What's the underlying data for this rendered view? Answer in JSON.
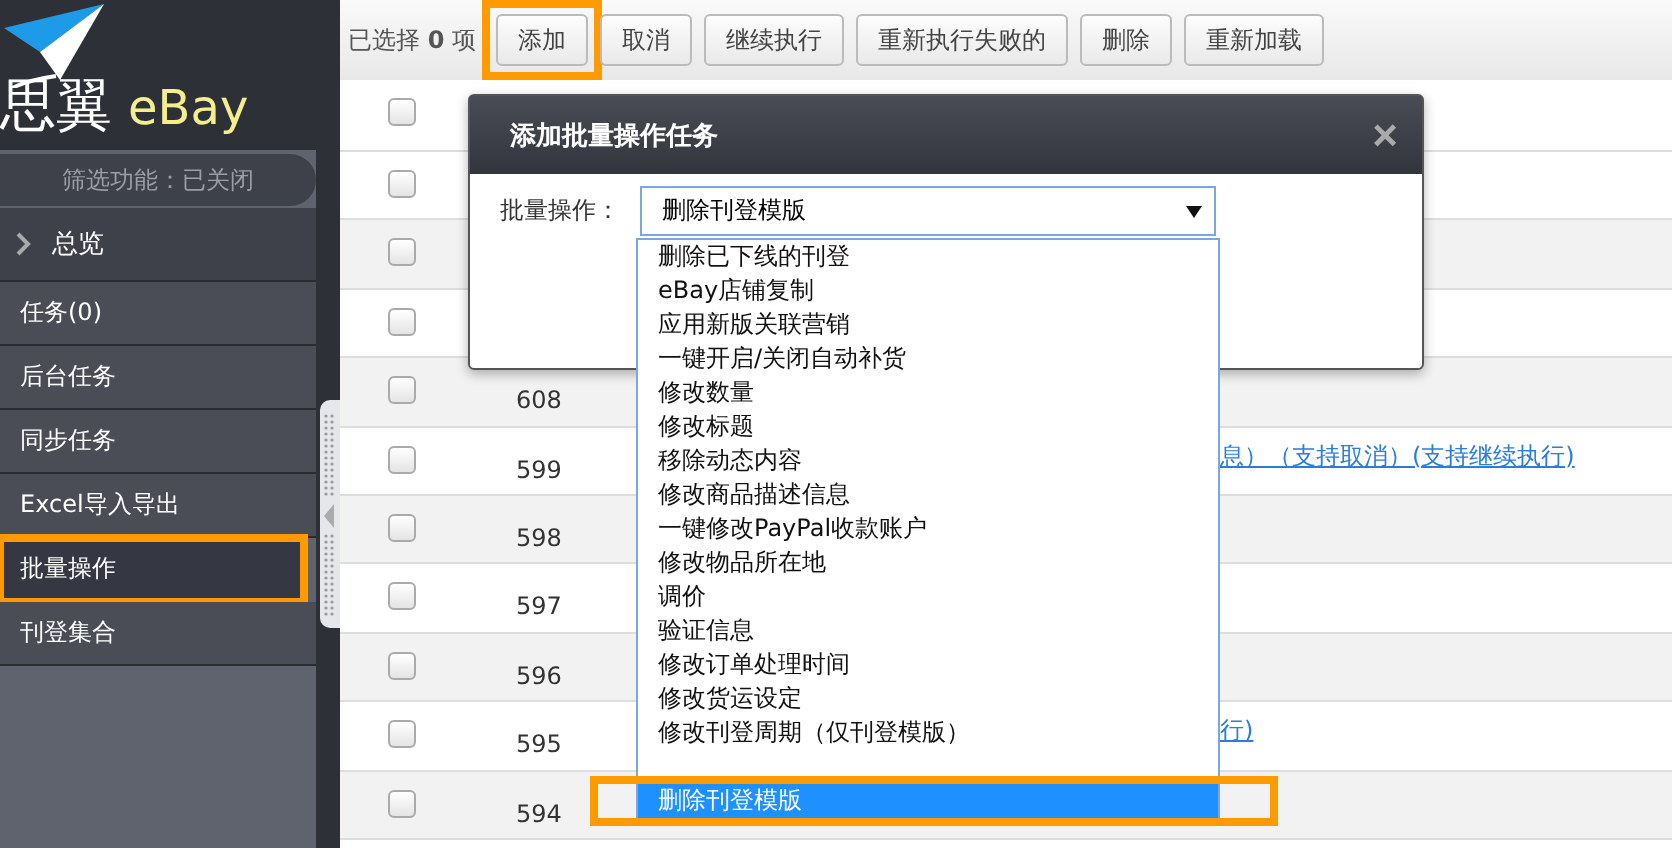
{
  "logo": {
    "name": "思翼",
    "brand": "eBay"
  },
  "sidebar": {
    "filter": "筛选功能：已关闭",
    "overview": "总览",
    "items": [
      {
        "label": "任务(0)",
        "selected": false,
        "highlighted": false
      },
      {
        "label": "后台任务",
        "selected": false,
        "highlighted": false
      },
      {
        "label": "同步任务",
        "selected": false,
        "highlighted": false
      },
      {
        "label": "Excel导入导出",
        "selected": false,
        "highlighted": false
      },
      {
        "label": "批量操作",
        "selected": true,
        "highlighted": true
      },
      {
        "label": "刊登集合",
        "selected": false,
        "highlighted": false
      }
    ]
  },
  "toolbar": {
    "selection": "已选择 **0** 项",
    "buttons": [
      {
        "label": "添加",
        "highlighted": true
      },
      {
        "label": "取消",
        "highlighted": false
      },
      {
        "label": "继续执行",
        "highlighted": false
      },
      {
        "label": "重新执行失败的",
        "highlighted": false
      },
      {
        "label": "删除",
        "highlighted": false
      },
      {
        "label": "重新加载",
        "highlighted": false
      }
    ]
  },
  "table": {
    "header_checked": false,
    "rows": [
      {
        "checked": false
      },
      {
        "checked": false
      },
      {
        "checked": false
      },
      {
        "checked": false,
        "number": "608"
      },
      {
        "checked": false,
        "number": "599",
        "column_3_tail": "息）（支持取消）(支持继续执行)"
      },
      {
        "checked": false,
        "number": "598"
      },
      {
        "checked": false,
        "number": "597"
      },
      {
        "checked": false,
        "number": "596"
      },
      {
        "checked": false,
        "number": "595",
        "column_3_tail": "行)"
      },
      {
        "checked": false,
        "number": "594"
      }
    ]
  },
  "dialog": {
    "title": "添加批量操作任务",
    "close": "×",
    "label": "批量操作：",
    "value": "删除刊登模版",
    "options": [
      {
        "label": "删除已下线的刊登",
        "selected": false,
        "highlighted": false
      },
      {
        "label": "eBay店铺复制",
        "selected": false,
        "highlighted": false
      },
      {
        "label": "应用新版关联营销",
        "selected": false,
        "highlighted": false
      },
      {
        "label": "一键开启/关闭自动补货",
        "selected": false,
        "highlighted": false
      },
      {
        "label": "修改数量",
        "selected": false,
        "highlighted": false
      },
      {
        "label": "修改标题",
        "selected": false,
        "highlighted": false
      },
      {
        "label": "移除动态内容",
        "selected": false,
        "highlighted": false
      },
      {
        "label": "修改商品描述信息",
        "selected": false,
        "highlighted": false
      },
      {
        "label": "一键修改PayPal收款账户",
        "selected": false,
        "highlighted": false
      },
      {
        "label": "修改物品所在地",
        "selected": false,
        "highlighted": false
      },
      {
        "label": "调价",
        "selected": false,
        "highlighted": false
      },
      {
        "label": "验证信息",
        "selected": false,
        "highlighted": false
      },
      {
        "label": "修改订单处理时间",
        "selected": false,
        "highlighted": false
      },
      {
        "label": "修改货运设定",
        "selected": false,
        "highlighted": false
      },
      {
        "label": "修改刊登周期（仅刊登模版）",
        "selected": false,
        "highlighted": false
      },
      {
        "label": "删除刊登模版",
        "selected": true,
        "highlighted": true
      }
    ]
  }
}
